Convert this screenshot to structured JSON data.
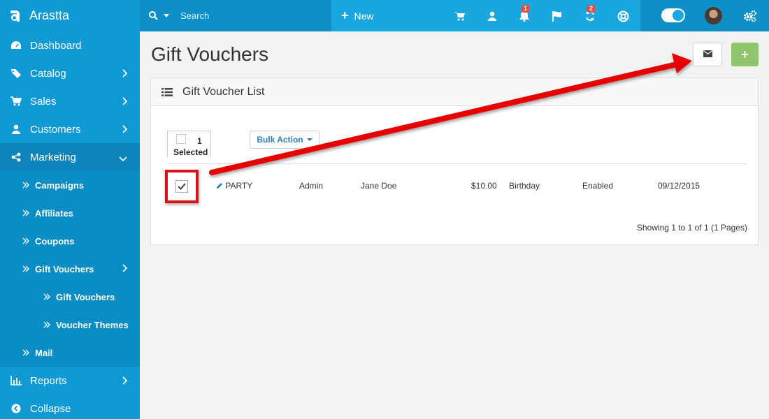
{
  "app": {
    "brand": "Arastta"
  },
  "topbar": {
    "search_placeholder": "Search",
    "new_label": "New",
    "notifications_badge": "1",
    "refresh_badge": "2"
  },
  "sidebar": {
    "items": [
      {
        "label": "Dashboard",
        "icon": "dashboard-icon"
      },
      {
        "label": "Catalog",
        "icon": "tag-icon"
      },
      {
        "label": "Sales",
        "icon": "cart-icon"
      },
      {
        "label": "Customers",
        "icon": "user-icon"
      },
      {
        "label": "Marketing",
        "icon": "share-icon"
      },
      {
        "label": "Reports",
        "icon": "bar-chart-icon"
      },
      {
        "label": "Collapse",
        "icon": "collapse-icon"
      }
    ],
    "marketing_sub": [
      {
        "label": "Campaigns"
      },
      {
        "label": "Affiliates"
      },
      {
        "label": "Coupons"
      },
      {
        "label": "Gift Vouchers"
      }
    ],
    "gift_sub": [
      {
        "label": "Gift Vouchers"
      },
      {
        "label": "Voucher Themes"
      }
    ],
    "mail": "Mail"
  },
  "page": {
    "title": "Gift Vouchers"
  },
  "panel": {
    "title": "Gift Voucher List",
    "selected_count": "1",
    "selected_label": "Selected",
    "bulk_action": "Bulk Action",
    "row": {
      "code": "PARTY",
      "from": "Admin",
      "to": "Jane Doe",
      "amount": "$10.00",
      "theme": "Birthday",
      "status": "Enabled",
      "date": "09/12/2015"
    },
    "showing": "Showing 1 to 1 of 1 (1 Pages)"
  },
  "colors": {
    "sidebar": "#0f9ad5",
    "topbar": "#1aa7e0",
    "add_button": "#8fc56c",
    "annotation": "#e60000"
  }
}
